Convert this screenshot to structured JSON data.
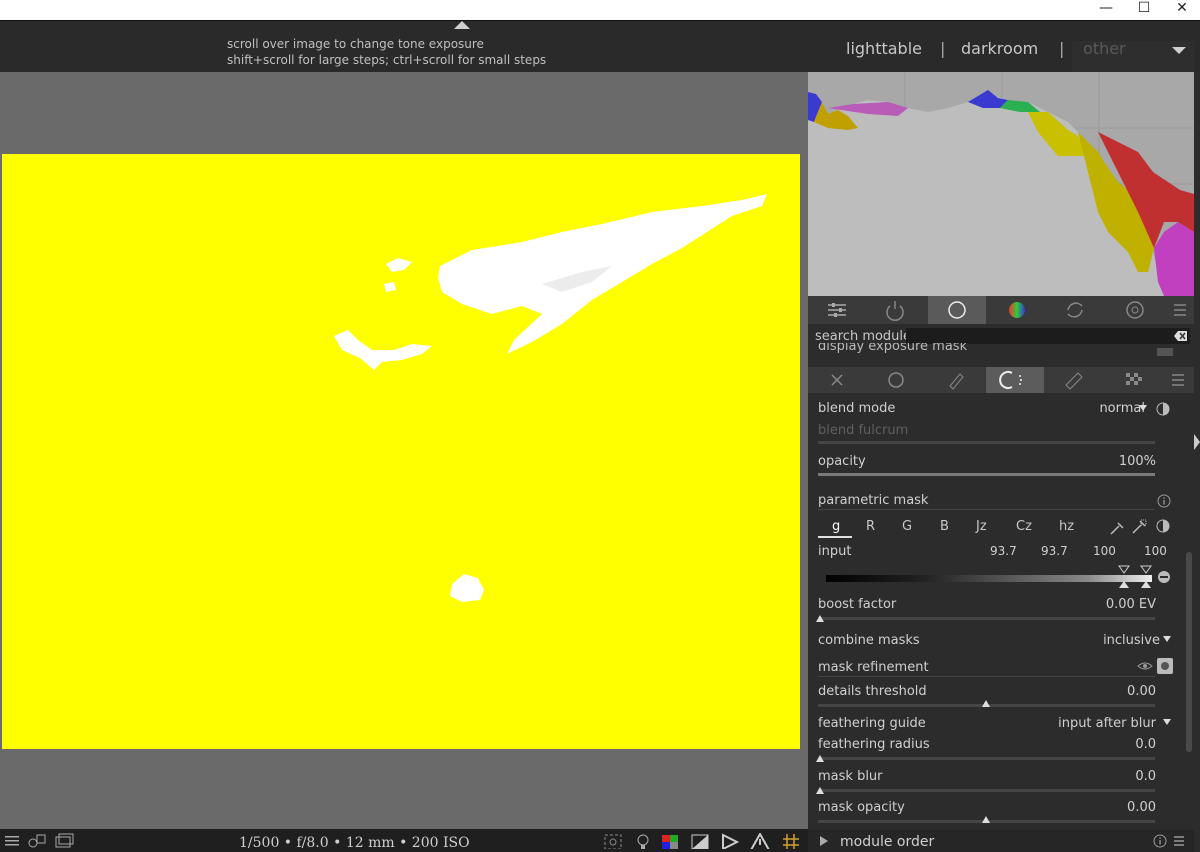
{
  "window": {
    "minimize": "—",
    "maximize": "☐",
    "close": "✕"
  },
  "header": {
    "hint_line1": "scroll over image to change tone exposure",
    "hint_line2": "shift+scroll for large steps; ctrl+scroll for small steps",
    "views": {
      "lighttable": "lighttable",
      "separator": "|",
      "darkroom": "darkroom",
      "other": "other"
    }
  },
  "image_info": {
    "exif": "1/500 • f/8.0 • 12 mm • 200 ISO"
  },
  "panel": {
    "search_label": "search module",
    "search_value": "",
    "cut_label": "display exposure mask",
    "blend_mode": {
      "label": "blend mode",
      "value": "normal"
    },
    "blend_fulcrum": {
      "label": "blend fulcrum"
    },
    "opacity": {
      "label": "opacity",
      "value": "100%",
      "level": 1.0
    },
    "parametric_mask": {
      "label": "parametric mask"
    },
    "channels": [
      "g",
      "R",
      "G",
      "B",
      "Jz",
      "Cz",
      "hz"
    ],
    "input": {
      "label": "input",
      "values": [
        "93.7",
        "93.7",
        "100",
        "100"
      ]
    },
    "boost_factor": {
      "label": "boost factor",
      "value": "0.00 EV",
      "level": 0.0
    },
    "combine_masks": {
      "label": "combine masks",
      "value": "inclusive"
    },
    "mask_refinement": {
      "label": "mask refinement"
    },
    "details_threshold": {
      "label": "details threshold",
      "value": "0.00",
      "level": 0.5
    },
    "feathering_guide": {
      "label": "feathering guide",
      "value": "input after blur"
    },
    "feathering_radius": {
      "label": "feathering radius",
      "value": "0.0",
      "level": 0.0
    },
    "mask_blur": {
      "label": "mask blur",
      "value": "0.0",
      "level": 0.0
    },
    "mask_opacity": {
      "label": "mask opacity",
      "value": "0.00",
      "level": 0.5
    },
    "module_order": "module order"
  },
  "colors": {
    "mask_overlay": "#ffff00",
    "background": "#6a6a6a",
    "panel": "#2c2c2c"
  }
}
